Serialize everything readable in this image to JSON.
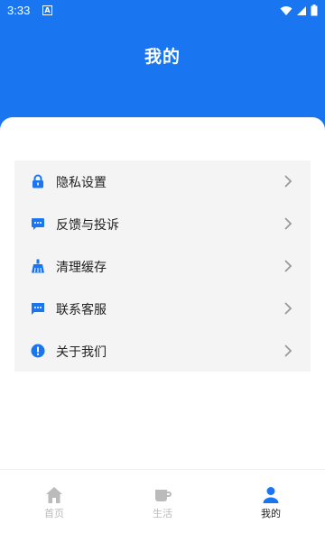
{
  "status_bar": {
    "time": "3:33",
    "notification_glyph": "A"
  },
  "header": {
    "title": "我的"
  },
  "menu": {
    "items": [
      {
        "label": "隐私设置",
        "icon": "lock-icon"
      },
      {
        "label": "反馈与投诉",
        "icon": "feedback-bubble-icon"
      },
      {
        "label": "清理缓存",
        "icon": "broom-icon"
      },
      {
        "label": "联系客服",
        "icon": "message-icon"
      },
      {
        "label": "关于我们",
        "icon": "info-icon"
      }
    ]
  },
  "bottom_nav": {
    "items": [
      {
        "label": "首页",
        "icon": "home-icon",
        "active": false
      },
      {
        "label": "生活",
        "icon": "coffee-cup-icon",
        "active": false
      },
      {
        "label": "我的",
        "icon": "person-icon",
        "active": true
      }
    ]
  },
  "colors": {
    "brand": "#1976f0",
    "card_bg": "#f4f4f4",
    "inactive": "#bbbbbb"
  }
}
